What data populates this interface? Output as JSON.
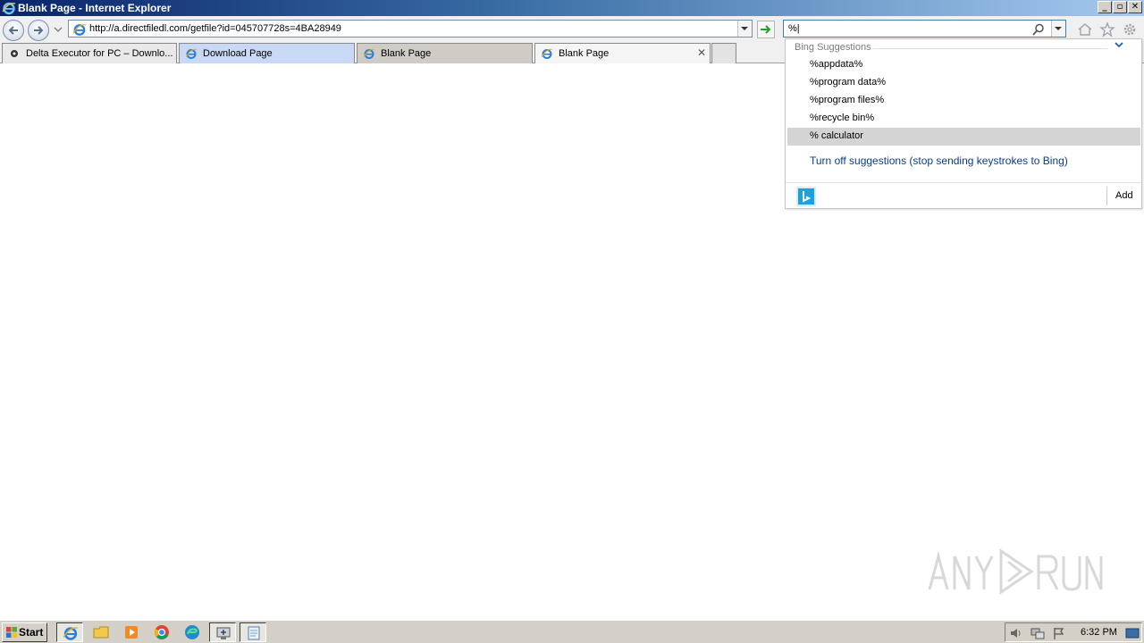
{
  "window": {
    "title": "Blank Page - Internet Explorer",
    "minimize": "_",
    "restore": "▫",
    "close": "✕"
  },
  "nav": {
    "url": "http://a.directfiledl.com/getfile?id=045707728s=4BA28949",
    "search_value": "%|"
  },
  "tabs": [
    {
      "label": "Delta Executor for PC – Downlo...",
      "icon": "dark-site-icon",
      "active": false
    },
    {
      "label": "Download Page",
      "icon": "ie-icon",
      "active": false
    },
    {
      "label": "Blank Page",
      "icon": "ie-icon",
      "active": false
    },
    {
      "label": "Blank Page",
      "icon": "ie-icon",
      "active": true
    }
  ],
  "tab_close": "✕",
  "suggestions": {
    "header": "Bing Suggestions",
    "items": [
      "%appdata%",
      "%program data%",
      "%program files%",
      "%recycle bin%",
      "% calculator"
    ],
    "selected_index": 4,
    "turn_off": "Turn off suggestions (stop sending keystrokes to Bing)",
    "add": "Add"
  },
  "taskbar": {
    "start": "Start",
    "clock": "6:32 PM",
    "apps": [
      "internet-explorer-icon",
      "file-explorer-icon",
      "media-player-icon",
      "chrome-icon",
      "edge-icon",
      "network-tool-icon",
      "notepad-icon"
    ]
  },
  "colors": {
    "title_gradient_start": "#0a246a",
    "link_blue": "#0a3e86",
    "selected_row": "#d4d4d4"
  }
}
